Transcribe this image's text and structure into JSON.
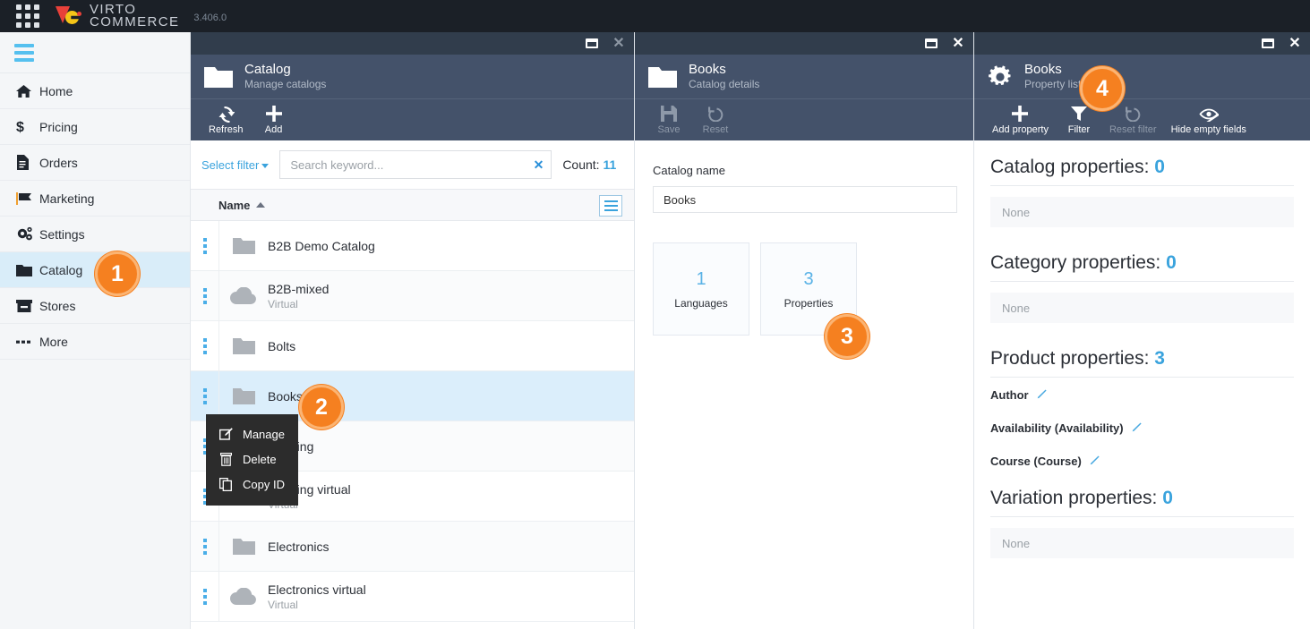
{
  "topbar": {
    "brand_line1": "VIRTO",
    "brand_line2": "COMMERCE",
    "version": "3.406.0",
    "waffle_icon": "apps-grid-icon"
  },
  "sidebar": {
    "menu_icon": "hamburger-icon",
    "items": [
      {
        "label": "Home",
        "icon": "home-icon",
        "active": false
      },
      {
        "label": "Pricing",
        "icon": "dollar-icon",
        "active": false
      },
      {
        "label": "Orders",
        "icon": "document-icon",
        "active": false
      },
      {
        "label": "Marketing",
        "icon": "flag-icon",
        "active": false
      },
      {
        "label": "Settings",
        "icon": "gears-icon",
        "active": false
      },
      {
        "label": "Catalog",
        "icon": "folder-icon",
        "active": true
      },
      {
        "label": "Stores",
        "icon": "store-icon",
        "active": false
      },
      {
        "label": "More",
        "icon": "ellipsis-icon",
        "active": false
      }
    ]
  },
  "catalog_panel": {
    "titlebar": {
      "restore_icon": "restore-window-icon",
      "close_icon": "close-icon"
    },
    "head_icon": "folder-icon",
    "title": "Catalog",
    "subtitle": "Manage catalogs",
    "toolbar": [
      {
        "label": "Refresh",
        "icon": "refresh-icon",
        "disabled": false
      },
      {
        "label": "Add",
        "icon": "plus-icon",
        "disabled": false
      }
    ],
    "filter": {
      "select_filter_label": "Select filter",
      "search_placeholder": "Search keyword...",
      "search_value": "",
      "clear_icon": "clear-x-icon",
      "count_label": "Count:",
      "count_value": "11"
    },
    "list": {
      "column_header": "Name",
      "sort_direction": "asc",
      "columns_button_icon": "columns-menu-icon",
      "rows": [
        {
          "name": "B2B Demo Catalog",
          "sub": "",
          "icon": "folder-icon",
          "selected": false
        },
        {
          "name": "B2B-mixed",
          "sub": "Virtual",
          "icon": "cloud-icon",
          "selected": false
        },
        {
          "name": "Bolts",
          "sub": "",
          "icon": "folder-icon",
          "selected": false
        },
        {
          "name": "Books",
          "sub": "",
          "icon": "folder-icon",
          "selected": true
        },
        {
          "name": "Clothing",
          "sub": "",
          "icon": "folder-icon",
          "selected": false
        },
        {
          "name": "Clothing virtual",
          "sub": "Virtual",
          "icon": "cloud-icon",
          "selected": false
        },
        {
          "name": "Electronics",
          "sub": "",
          "icon": "folder-icon",
          "selected": false
        },
        {
          "name": "Electronics virtual",
          "sub": "Virtual",
          "icon": "cloud-icon",
          "selected": false
        }
      ]
    },
    "context_menu": [
      {
        "label": "Manage",
        "icon": "edit-icon"
      },
      {
        "label": "Delete",
        "icon": "trash-icon"
      },
      {
        "label": "Copy ID",
        "icon": "copy-icon"
      }
    ]
  },
  "details_panel": {
    "titlebar": {
      "restore_icon": "restore-window-icon",
      "close_icon": "close-icon"
    },
    "head_icon": "folder-icon",
    "title": "Books",
    "subtitle": "Catalog details",
    "toolbar": [
      {
        "label": "Save",
        "icon": "save-icon",
        "disabled": true
      },
      {
        "label": "Reset",
        "icon": "reset-icon",
        "disabled": true
      }
    ],
    "catalog_name_label": "Catalog name",
    "catalog_name_value": "Books",
    "tiles": [
      {
        "count": "1",
        "label": "Languages"
      },
      {
        "count": "3",
        "label": "Properties"
      }
    ]
  },
  "properties_panel": {
    "titlebar": {
      "restore_icon": "restore-window-icon",
      "close_icon": "close-icon"
    },
    "head_icon": "gear-icon",
    "title": "Books",
    "subtitle": "Property list",
    "toolbar": [
      {
        "label": "Add property",
        "icon": "plus-icon",
        "disabled": false
      },
      {
        "label": "Filter",
        "icon": "funnel-icon",
        "disabled": false
      },
      {
        "label": "Reset filter",
        "icon": "reset-icon",
        "disabled": true
      },
      {
        "label": "Hide empty fields",
        "icon": "eye-slash-icon",
        "disabled": false
      }
    ],
    "sections": [
      {
        "title": "Catalog properties:",
        "count": "0",
        "empty_text": "None",
        "items": []
      },
      {
        "title": "Category properties:",
        "count": "0",
        "empty_text": "None",
        "items": []
      },
      {
        "title": "Product properties:",
        "count": "3",
        "empty_text": "",
        "items": [
          "Author",
          "Availability (Availability)",
          "Course (Course)"
        ]
      },
      {
        "title": "Variation properties:",
        "count": "0",
        "empty_text": "None",
        "items": []
      }
    ],
    "edit_icon": "pencil-icon"
  },
  "badges": [
    {
      "number": "1"
    },
    {
      "number": "2"
    },
    {
      "number": "3"
    },
    {
      "number": "4"
    }
  ],
  "colors": {
    "accent_blue": "#3aa3dd",
    "panel_header": "#44526a",
    "titlebar": "#313d4c",
    "topbar": "#1b2027",
    "badge_orange": "#f58020",
    "selected_row": "#dbeefb"
  }
}
